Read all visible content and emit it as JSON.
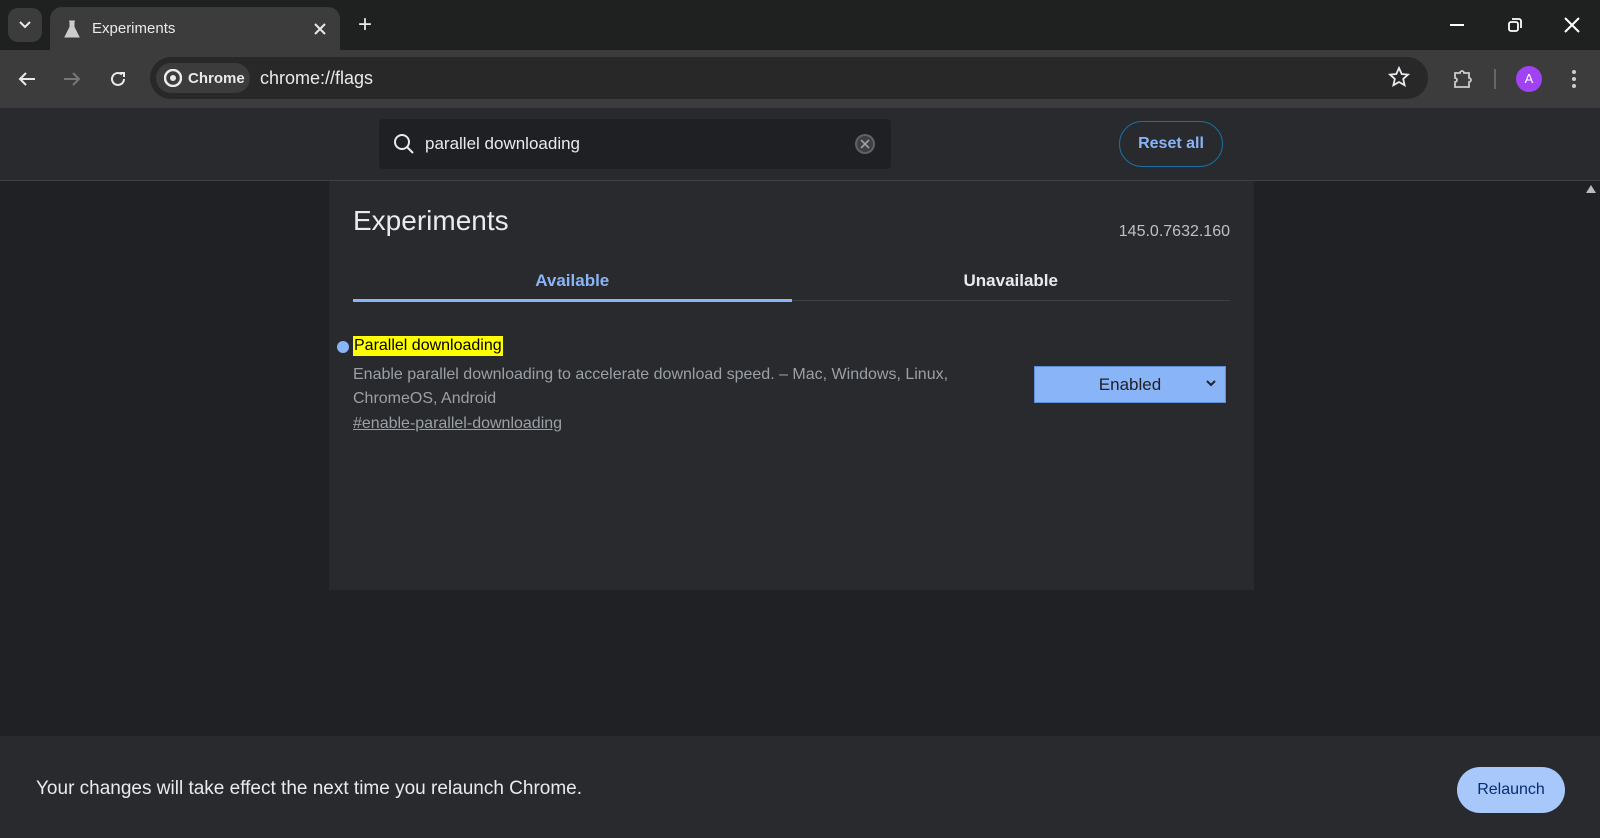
{
  "browser": {
    "tab_title": "Experiments",
    "chip_label": "Chrome",
    "url": "chrome://flags",
    "avatar_letter": "A"
  },
  "header": {
    "search_value": "parallel downloading",
    "reset_label": "Reset all"
  },
  "main": {
    "title": "Experiments",
    "version": "145.0.7632.160",
    "tabs": [
      {
        "label": "Available"
      },
      {
        "label": "Unavailable"
      }
    ],
    "flag": {
      "name": "Parallel downloading",
      "description": "Enable parallel downloading to accelerate download speed. – Mac, Windows, Linux, ChromeOS, Android",
      "link": "#enable-parallel-downloading",
      "value": "Enabled"
    }
  },
  "footer": {
    "message": "Your changes will take effect the next time you relaunch Chrome.",
    "relaunch_label": "Relaunch"
  },
  "colors": {
    "accent": "#8ab4f8",
    "highlight": "#ffff00",
    "avatar": "#a142f4"
  }
}
